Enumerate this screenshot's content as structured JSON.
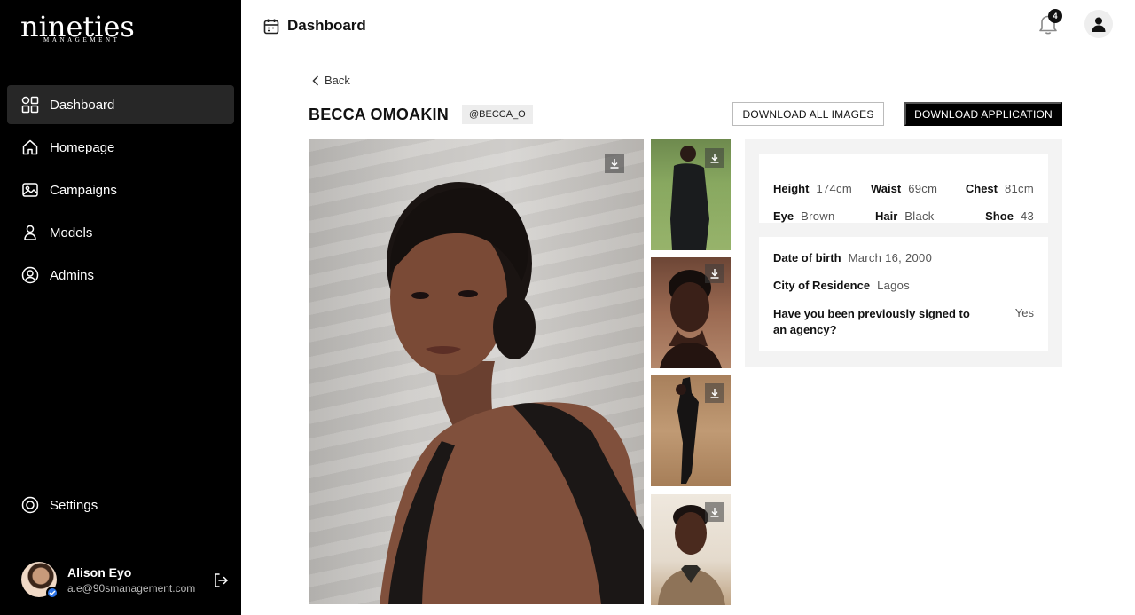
{
  "brand": {
    "logo_text": "nineties",
    "logo_subtext": "MANAGEMENT"
  },
  "sidebar": {
    "items": [
      {
        "label": "Dashboard",
        "icon": "dashboard-grid-icon",
        "active": true
      },
      {
        "label": "Homepage",
        "icon": "home-icon",
        "active": false
      },
      {
        "label": "Campaigns",
        "icon": "image-gallery-icon",
        "active": false
      },
      {
        "label": "Models",
        "icon": "person-icon",
        "active": false
      },
      {
        "label": "Admins",
        "icon": "user-circle-icon",
        "active": false
      }
    ],
    "settings_label": "Settings",
    "user": {
      "name": "Alison Eyo",
      "email": "a.e@90smanagement.com"
    }
  },
  "header": {
    "title": "Dashboard",
    "notification_count": "4"
  },
  "main": {
    "back_label": "Back",
    "model_name": "BECCA OMOAKIN",
    "handle": "@BECCA_O",
    "download_all_label": "DOWNLOAD ALL IMAGES",
    "download_application_label": "DOWNLOAD APPLICATION",
    "measurements": {
      "height": {
        "label": "Height",
        "value": "174cm"
      },
      "waist": {
        "label": "Waist",
        "value": "69cm"
      },
      "chest": {
        "label": "Chest",
        "value": "81cm"
      },
      "eye": {
        "label": "Eye",
        "value": "Brown"
      },
      "hair": {
        "label": "Hair",
        "value": "Black"
      },
      "shoe": {
        "label": "Shoe",
        "value": "43"
      }
    },
    "details": {
      "dob": {
        "label": "Date of birth",
        "value": "March 16, 2000"
      },
      "city": {
        "label": "City of Residence",
        "value": "Lagos"
      },
      "signed": {
        "label": "Have you been previously signed to an agency?",
        "value": "Yes"
      }
    }
  },
  "colors": {
    "sidebar_bg": "#000000",
    "active_item_bg": "#272727",
    "accent_verified": "#2f76e8"
  }
}
